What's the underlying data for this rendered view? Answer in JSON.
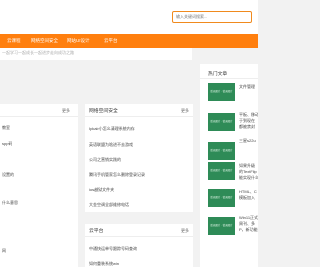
{
  "search": {
    "placeholder": "输入关键词搜索..."
  },
  "nav": {
    "items": [
      "云课程",
      "网络空间安全",
      "网站UI设计",
      "云平台"
    ]
  },
  "breadcrumb": "一起学习一起成长一起进步走向成功之路",
  "left_panel": {
    "more": "更多",
    "items": [
      "教室",
      "spp码",
      "",
      "",
      "设置的",
      "什么意思",
      "",
      "",
      "网"
    ]
  },
  "security_panel": {
    "title": "网络空间安全",
    "more": "更多",
    "items": [
      "Ipkalr小怎么清理系统内存",
      "英语联盟为啥进不去游戏",
      "公司之营销实践的",
      "腾讯手机管家怎么删除登录记录",
      "ios越狱文件夹",
      "大金空调全部维修电话"
    ]
  },
  "cloud_panel": {
    "title": "云平台",
    "more": "更多",
    "items": [
      "中通快运单号跟踪号码查询",
      "如何重装系统win"
    ]
  },
  "hot": {
    "title": "热门文章",
    "thumb_label": "暂无图片 · 暂无图片",
    "items": [
      [
        "文件管理"
      ],
      [
        "平板、移动",
        "于到现在",
        "都被禁封"
      ],
      [
        "三星s22u"
      ],
      [
        "如果升级",
        "的TextFlip",
        "能实现什么"
      ],
      [
        "HTML、C",
        "模板加入"
      ],
      [
        "Win11正式",
        "周刊、多",
        "P，新功能"
      ]
    ]
  },
  "colors": {
    "accent": "#ff7f0e",
    "thumb": "#2e8b57"
  }
}
